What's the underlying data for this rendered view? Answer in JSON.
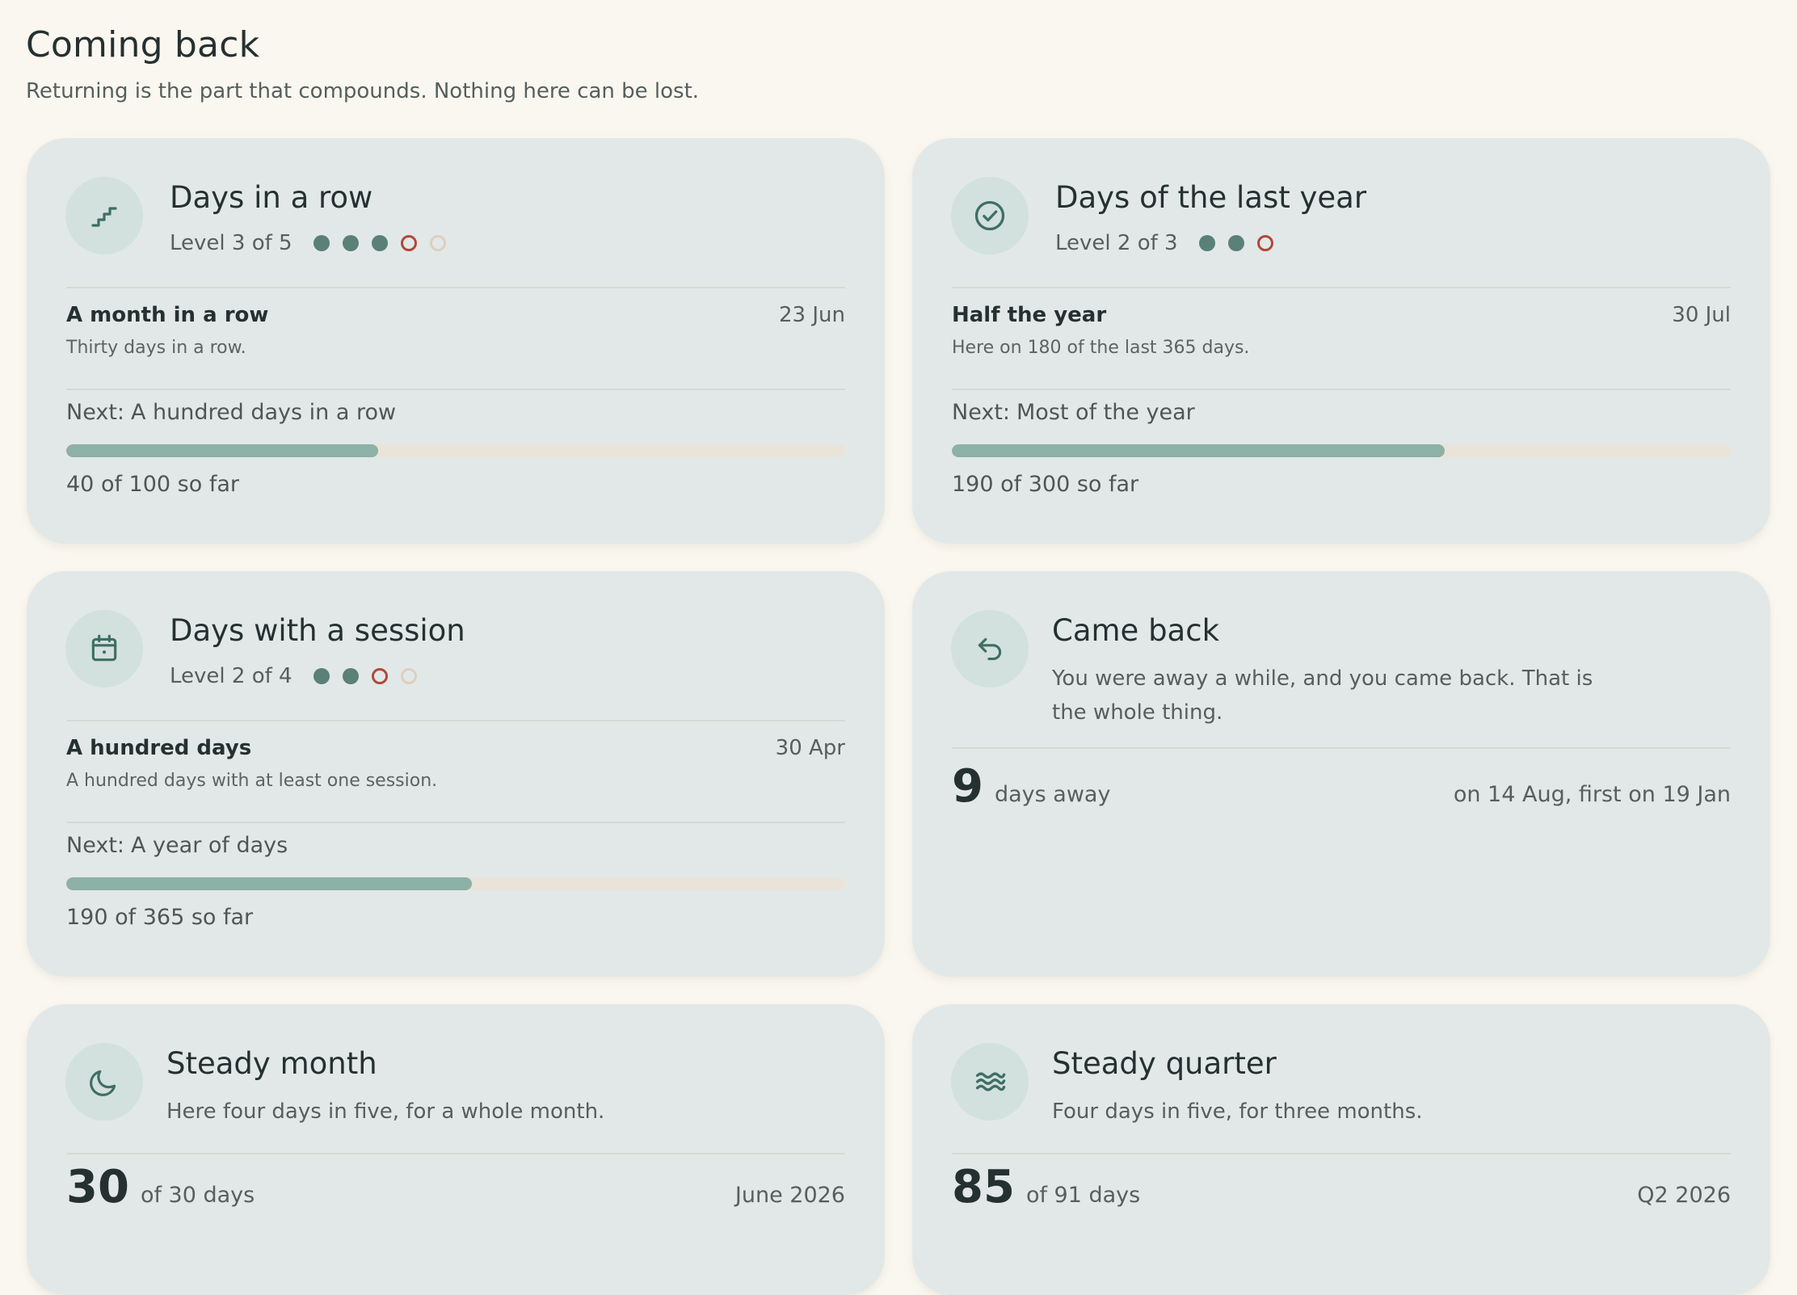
{
  "header": {
    "title": "Coming back",
    "subtitle": "Returning is the part that compounds. Nothing here can be lost."
  },
  "cards": [
    {
      "icon": "stairs-icon",
      "title": "Days in a row",
      "level_text": "Level 3 of 5",
      "levels": [
        "filled",
        "filled",
        "filled",
        "current",
        "empty"
      ],
      "achievement": {
        "name": "A month in a row",
        "date": "23 Jun",
        "description": "Thirty days in a row."
      },
      "next": {
        "prefix": "Next:",
        "name": "A hundred days in a row"
      },
      "progress": {
        "value": 40,
        "target": 100,
        "fraction": 0.4,
        "label": "40 of 100 so far"
      }
    },
    {
      "icon": "check-circle-icon",
      "title": "Days of the last year",
      "level_text": "Level 2 of 3",
      "levels": [
        "filled",
        "filled",
        "current"
      ],
      "achievement": {
        "name": "Half the year",
        "date": "30 Jul",
        "description": "Here on 180 of the last 365 days."
      },
      "next": {
        "prefix": "Next:",
        "name": "Most of the year"
      },
      "progress": {
        "value": 190,
        "target": 300,
        "fraction": 0.633,
        "label": "190 of 300 so far"
      }
    },
    {
      "icon": "calendar-icon",
      "title": "Days with a session",
      "level_text": "Level 2 of 4",
      "levels": [
        "filled",
        "filled",
        "current",
        "empty"
      ],
      "achievement": {
        "name": "A hundred days",
        "date": "30 Apr",
        "description": "A hundred days with at least one session."
      },
      "next": {
        "prefix": "Next:",
        "name": "A year of days"
      },
      "progress": {
        "value": 190,
        "target": 365,
        "fraction": 0.521,
        "label": "190 of 365 so far"
      }
    },
    {
      "icon": "return-arrow-icon",
      "title": "Came back",
      "description": "You were away a while, and you came back. That is the whole thing.",
      "stat": {
        "value": "9",
        "unit": "days away",
        "detail": "on 14 Aug, first on 19 Jan"
      }
    },
    {
      "icon": "moon-icon",
      "title": "Steady month",
      "description": "Here four days in five, for a whole month.",
      "stat": {
        "value": "30",
        "unit": "of 30 days",
        "detail": "June 2026"
      }
    },
    {
      "icon": "waves-icon",
      "title": "Steady quarter",
      "description": "Four days in five, for three months.",
      "stat": {
        "value": "85",
        "unit": "of 91 days",
        "detail": "Q2 2026"
      }
    }
  ],
  "colors": {
    "background": "#faf7f0",
    "card": "#e2e8e8",
    "accent": "#5a8078",
    "progress_fill": "#8db1a5",
    "progress_track": "#e9e3d8",
    "current_level": "#b0483a",
    "empty_level": "#ddcfbf"
  }
}
